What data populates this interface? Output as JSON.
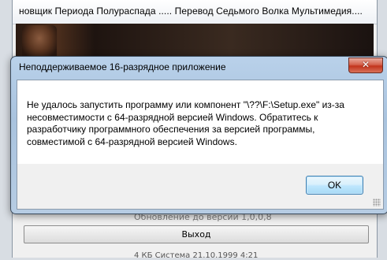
{
  "background_window": {
    "title": "новщик  Периода Полураспада ..... Перевод Седьмого Волка Мультимедия....",
    "update_label": "Обновление до версии 1,0,0,8",
    "exit_label": "Выход",
    "footer_text": "4 КБ    Система   21.10.1999 4:21"
  },
  "dialog": {
    "title": "Неподдерживаемое 16-разрядное приложение",
    "close_glyph": "✕",
    "message": "Не удалось запустить программу или компонент \"\\??\\F:\\Setup.exe\" из-за несовместимости с 64-разрядной версией Windows. Обратитесь к разработчику программного обеспечения за версией программы, совместимой с 64-разрядной версией Windows.",
    "ok_label": "OK"
  }
}
